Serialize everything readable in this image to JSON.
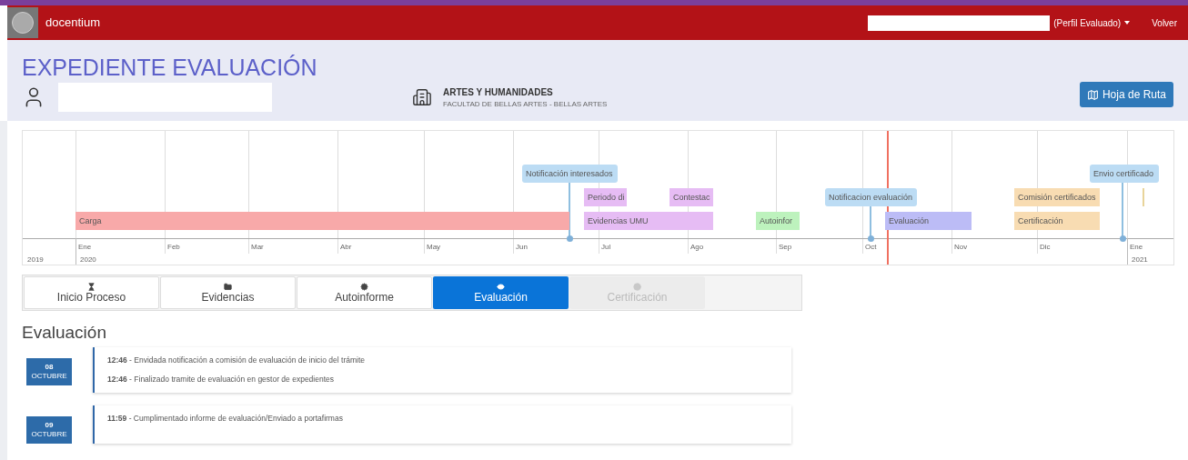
{
  "navbar": {
    "brand": "docentium",
    "profile_menu": "(Perfil Evaluado)",
    "back_link": "Volver"
  },
  "header": {
    "title": "EXPEDIENTE EVALUACIÓN",
    "area": "ARTES Y HUMANIDADES",
    "faculty": "FACULTAD DE BELLAS ARTES - BELLAS ARTES",
    "route_button": "Hoja de Ruta"
  },
  "timeline": {
    "months": [
      "Ene",
      "Feb",
      "Mar",
      "Abr",
      "May",
      "Jun",
      "Jul",
      "Ago",
      "Sep",
      "Oct",
      "Nov",
      "Dic",
      "Ene"
    ],
    "years": [
      "2019",
      "2020",
      "2021"
    ],
    "items": [
      {
        "label": "Notificación interesados",
        "kind": "point",
        "color": "#bcdcf4"
      },
      {
        "label": "Periodo di",
        "kind": "range",
        "color": "#e6bcf4"
      },
      {
        "label": "Contestac",
        "kind": "range",
        "color": "#e6bcf4"
      },
      {
        "label": "Carga",
        "kind": "range",
        "color": "#f8a9a9"
      },
      {
        "label": "Evidencias UMU",
        "kind": "range",
        "color": "#e6bcf4"
      },
      {
        "label": "Autoinfor",
        "kind": "range",
        "color": "#bdf2bd"
      },
      {
        "label": "Notificacion evaluación",
        "kind": "point",
        "color": "#bcdcf4"
      },
      {
        "label": "Evaluación",
        "kind": "range",
        "color": "#bcbcf6"
      },
      {
        "label": "Comisión certificados",
        "kind": "range",
        "color": "#f8dcb2"
      },
      {
        "label": "Certificación",
        "kind": "range",
        "color": "#f8dcb2"
      },
      {
        "label": "Envio certificado",
        "kind": "point",
        "color": "#bcdcf4"
      },
      {
        "kind": "marker",
        "color": "#e8d49a"
      }
    ]
  },
  "tabs": [
    {
      "label": "Inicio Proceso",
      "selected": false,
      "disabled": false
    },
    {
      "label": "Evidencias",
      "selected": false,
      "disabled": false
    },
    {
      "label": "Autoinforme",
      "selected": false,
      "disabled": false
    },
    {
      "label": "Evaluación",
      "selected": true,
      "disabled": false
    },
    {
      "label": "Certificación",
      "selected": false,
      "disabled": true
    }
  ],
  "section_title": "Evaluación",
  "entries": [
    {
      "day": "08",
      "month": "OCTUBRE",
      "events": [
        "**12:46** - Envidada notificación a comisión de evaluación de inicio del trámite",
        "**12:46** - Finalizado tramite de evaluación en gestor de expedientes"
      ]
    },
    {
      "day": "09",
      "month": "OCTUBRE",
      "events": [
        "**11:59** - Cumplimentado informe de evaluación/Enviado a portafirmas"
      ]
    }
  ]
}
